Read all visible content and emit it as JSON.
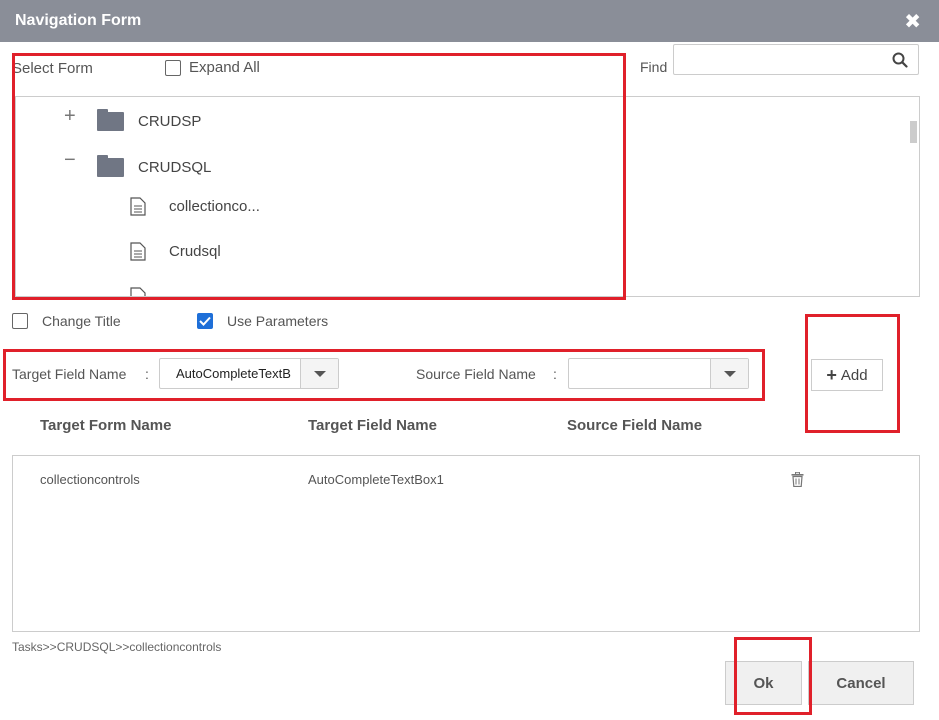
{
  "dialog": {
    "title": "Navigation Form"
  },
  "select_form": {
    "label": "Select Form",
    "expand_all_label": "Expand All",
    "expand_all_checked": false
  },
  "find": {
    "label": "Find",
    "value": ""
  },
  "tree": {
    "nodes": [
      {
        "toggle": "+",
        "label": "CRUDSP",
        "type": "folder"
      },
      {
        "toggle": "−",
        "label": "CRUDSQL",
        "type": "folder"
      },
      {
        "label": "collectionco...",
        "type": "form"
      },
      {
        "label": "Crudsql",
        "type": "form"
      }
    ]
  },
  "options": {
    "change_title_label": "Change Title",
    "change_title_checked": false,
    "use_parameters_label": "Use Parameters",
    "use_parameters_checked": true
  },
  "mapping": {
    "target_label": "Target Field Name",
    "target_colon": ":",
    "target_value": "AutoCompleteTextB",
    "source_label": "Source Field Name",
    "source_colon": ":",
    "source_value": "",
    "add_label": "Add"
  },
  "grid": {
    "headers": [
      "Target Form Name",
      "Target Field Name",
      "Source Field Name"
    ],
    "rows": [
      {
        "target_form": "collectioncontrols",
        "target_field": "AutoCompleteTextBox1",
        "source_field": ""
      }
    ]
  },
  "breadcrumb": "Tasks>>CRUDSQL>>collectioncontrols",
  "footer": {
    "ok_label": "Ok",
    "cancel_label": "Cancel"
  },
  "colors": {
    "titlebar": "#8a8e98",
    "highlight": "#e0202a",
    "checkbox_checked": "#1e6fd8",
    "folder": "#707684"
  },
  "icons": [
    "close-icon",
    "search-icon",
    "folder-icon",
    "document-icon",
    "checkmark-icon",
    "chevron-down-icon",
    "plus-icon",
    "trash-icon"
  ]
}
